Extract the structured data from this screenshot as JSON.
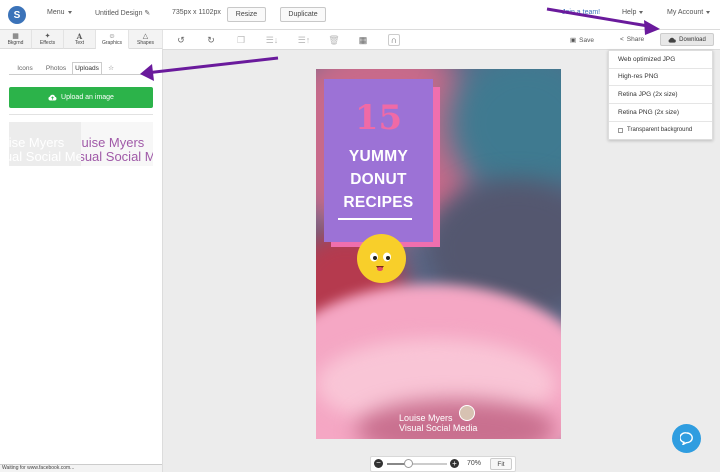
{
  "header": {
    "logo_letter": "S",
    "menu_label": "Menu",
    "design_title": "Untitled Design",
    "dimensions": "735px x 1102px",
    "resize_label": "Resize",
    "duplicate_label": "Duplicate",
    "team_link": "Join a team!",
    "help_label": "Help",
    "account_label": "My Account"
  },
  "left_tabs": [
    {
      "label": "Bkgrnd",
      "icon": "background-icon"
    },
    {
      "label": "Effects",
      "icon": "effects-icon"
    },
    {
      "label": "Text",
      "icon": "text-icon"
    },
    {
      "label": "Graphics",
      "icon": "graphics-icon"
    },
    {
      "label": "Shapes",
      "icon": "shapes-icon"
    }
  ],
  "sub_tabs": {
    "icons": "Icons",
    "photos": "Photos",
    "uploads": "Uploads"
  },
  "upload_button": "Upload an image",
  "thumbnails": [
    {
      "line1": "Louise Myers",
      "line2": "Visual Social Media"
    },
    {
      "line1": "Louise Myers",
      "line2": "Visual Social Media"
    }
  ],
  "toolbar": {
    "save_label": "Save",
    "share_label": "Share",
    "download_label": "Download"
  },
  "download_menu": {
    "items": [
      "Web optimized JPG",
      "High-res PNG",
      "Retina JPG (2x size)",
      "Retina PNG (2x size)"
    ],
    "transparent_label": "Transparent background"
  },
  "design": {
    "number": "15",
    "line1": "YUMMY",
    "line2": "DONUT",
    "line3": "RECIPES",
    "credit_name": "Louise Myers",
    "credit_tagline": "Visual Social Media"
  },
  "zoom": {
    "value": "70%",
    "fit_label": "Fit",
    "level": 0.35
  },
  "status_text": "Waiting for www.facebook.com...",
  "colors": {
    "accent_blue": "#3b73b9",
    "upload_green": "#2cb34a",
    "title_box": "#9c72d6",
    "number_pink": "#f06aa6",
    "chat_blue": "#2f9de0"
  }
}
